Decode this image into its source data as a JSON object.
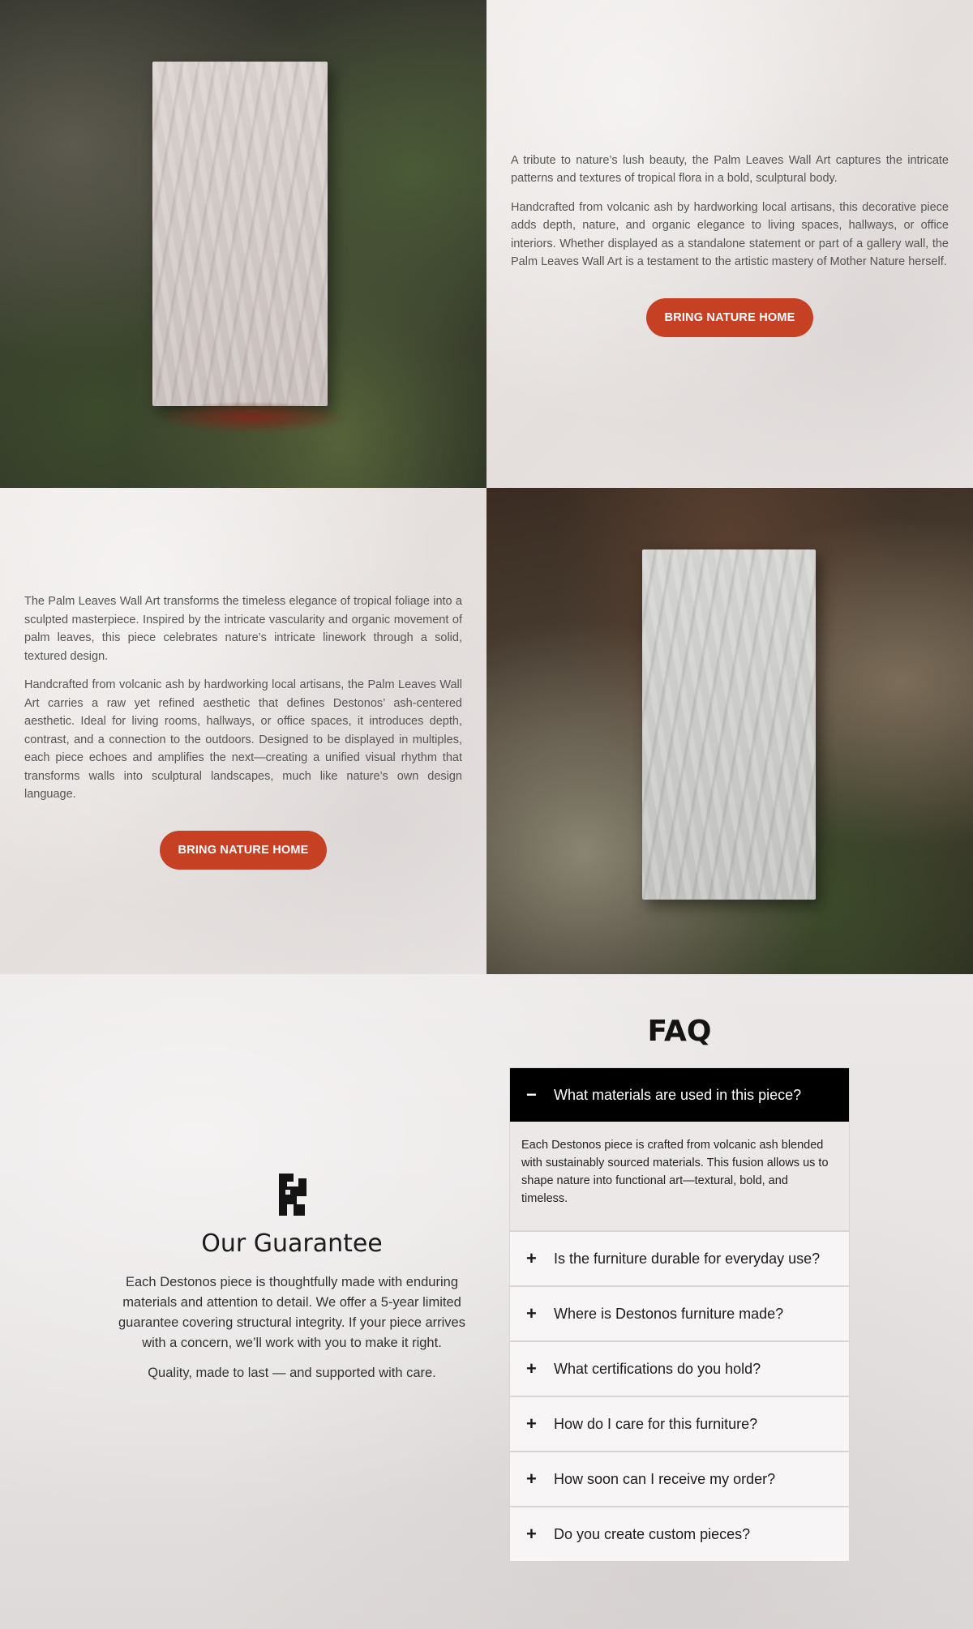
{
  "section1": {
    "paragraphs": [
      "A tribute to nature’s lush beauty, the Palm Leaves Wall Art captures the intricate patterns and textures of tropical flora in a bold, sculptural body.",
      "Handcrafted from volcanic ash by hardworking local artisans, this decorative piece adds depth, nature, and organic elegance to living spaces, hallways, or office interiors. Whether displayed as a standalone statement or part of a gallery wall, the Palm Leaves Wall Art is a testament to the artistic mastery of Mother Nature herself."
    ],
    "cta_label": "BRING NATURE HOME"
  },
  "section2": {
    "paragraphs": [
      "The Palm Leaves Wall Art transforms the timeless elegance of tropical foliage into a sculpted masterpiece. Inspired by the intricate vascularity and organic movement of palm leaves, this piece celebrates nature’s intricate linework through a solid, textured design.",
      "Handcrafted from volcanic ash by hardworking local artisans, the Palm Leaves Wall Art carries a raw yet refined aesthetic that defines Destonos’ ash-centered aesthetic. Ideal for living rooms, hallways, or office spaces, it introduces depth, contrast, and a connection to the outdoors. Designed to be displayed in multiples, each piece echoes and amplifies the next—creating a unified visual rhythm that transforms walls into sculptural landscapes, much like nature’s own design language."
    ],
    "cta_label": "BRING NATURE HOME"
  },
  "guarantee": {
    "icon": "destonos-logo-icon",
    "title": "Our Guarantee",
    "body": "Each Destonos piece is thoughtfully made with enduring materials and attention to detail. We offer a 5-year limited guarantee covering structural integrity. If your piece arrives with a concern, we’ll work with you to make it right.",
    "tagline": "Quality, made to last — and supported with care."
  },
  "faq": {
    "title": "FAQ",
    "open_sign": "−",
    "closed_sign": "+",
    "items": [
      {
        "question": "What materials are used in this piece?",
        "answer": "Each Destonos piece is crafted from volcanic ash blended with sustainably sourced materials. This fusion allows us to shape nature into functional art—textural, bold, and timeless."
      },
      {
        "question": "Is the furniture durable for everyday use?"
      },
      {
        "question": "Where is Destonos furniture made?"
      },
      {
        "question": "What certifications do you hold?"
      },
      {
        "question": "How do I care for this furniture?"
      },
      {
        "question": "How soon can I receive my order?"
      },
      {
        "question": "Do you create custom pieces?"
      }
    ]
  },
  "colors": {
    "accent": "#c64123",
    "faq_open_bg": "#000000"
  }
}
